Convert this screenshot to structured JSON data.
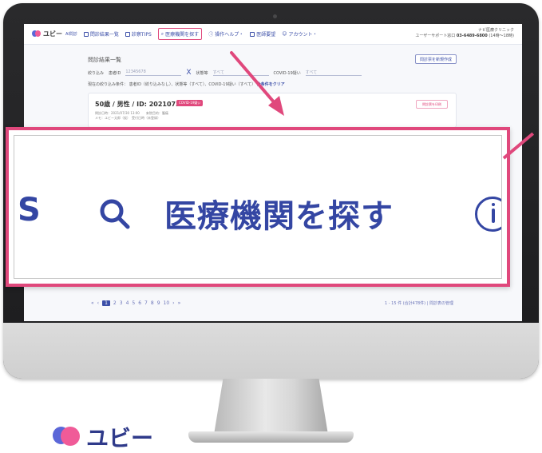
{
  "app": {
    "brand_name": "ユビー",
    "brand_suffix": "AI問診",
    "colors": {
      "brand_blue": "#3446a3",
      "brand_pink": "#e0487c",
      "heart_blue": "#5b67d8",
      "heart_pink": "#f05b98"
    }
  },
  "header": {
    "nav": [
      {
        "label": "問診結果一覧",
        "icon": "list-icon"
      },
      {
        "label": "診察TIPS",
        "icon": "book-icon"
      },
      {
        "label": "医療機関を探す",
        "icon": "search-icon",
        "active": true
      },
      {
        "label": "操作ヘルプ・",
        "icon": "info-icon"
      },
      {
        "label": "医師要望",
        "icon": "document-icon"
      },
      {
        "label": "アカウント・",
        "icon": "user-icon"
      }
    ],
    "right_line1": "ナビ医療クリニック",
    "right_line2_prefix": "ユーザーサポート窓口",
    "right_phone": "03-6489-6800",
    "right_line2_suffix": "(14時〜18時)"
  },
  "main": {
    "page_title": "問診結果一覧",
    "new_button": "問診票を新規作成",
    "filter": {
      "label": "絞り込み",
      "patient_no_label": "患者ID",
      "patient_no_placeholder": "12345678",
      "clear_symbol": "X",
      "status_label": "状態等",
      "status_value": "すべて",
      "covid_label": "COVID-19疑い",
      "covid_value": "すべて"
    },
    "conditions": {
      "prefix": "現在の絞り込み条件：",
      "text": "患者ID（絞り込みなし）、状態等（すべて）、COVID-19疑い（すべて）",
      "clear_link": "全条件をクリア"
    },
    "card": {
      "title": "50歳 / 男性 / ID: 20210730",
      "tag": "COVID-19疑い",
      "sub1": "問診日時：2021/07/30 13:00　　来院目的：腹痛",
      "sub2": "メモ：ユビー太郎（仮）　受付日時（未登録）",
      "button": "問診票を印刷"
    },
    "pager": {
      "prev": "«",
      "prev2": "‹",
      "pages": [
        "1",
        "2",
        "3",
        "4",
        "5",
        "6",
        "7",
        "8",
        "9",
        "10"
      ],
      "current": "1",
      "next": "›",
      "next2": "»",
      "summary": "1 - 15 件 (合計478件) | 問診表の管理"
    }
  },
  "zoom": {
    "left_fragment": "S",
    "label": "医療機関を探す"
  },
  "footer_logo": {
    "text": "ユビー"
  }
}
